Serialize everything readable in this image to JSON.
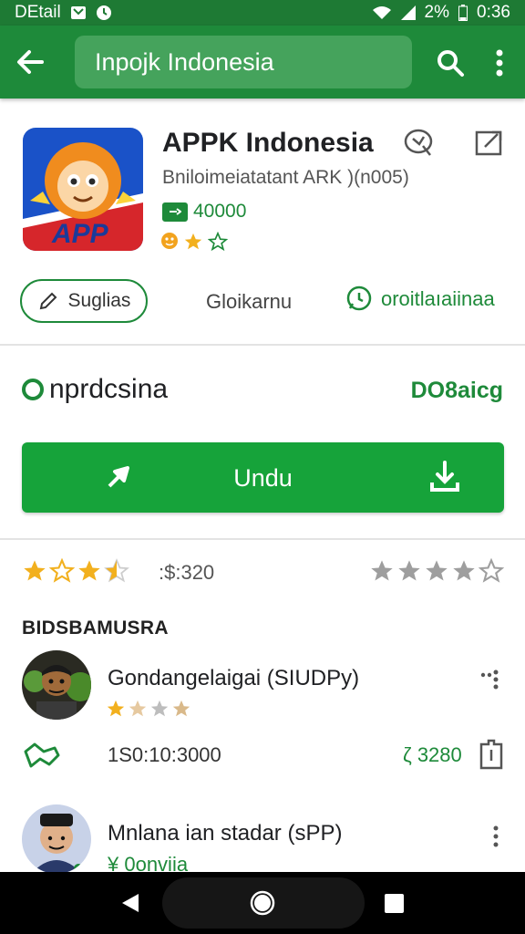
{
  "status_bar": {
    "left_label": "DEtail",
    "battery": "2%",
    "time": "0:36"
  },
  "search": {
    "value": "Inpojk Indonesia"
  },
  "app": {
    "title": "APPK Indonesia",
    "subtitle": "Bniloimeiatatant ARK )(n005)",
    "price": "40000",
    "icon_text": "APP"
  },
  "actions": {
    "pill_label": "Suglias",
    "mid_label": "Gloikarnu",
    "right_label": "oroitlaıaiinaa"
  },
  "install": {
    "label": "nprdcsina",
    "status": "DO8aicg"
  },
  "main_button": {
    "label": "Undu"
  },
  "rating": {
    "count_text": ":$:320",
    "value": 3.5
  },
  "reviews_section": {
    "title": "BIDSBAMUSRA",
    "reviews": [
      {
        "name": "Gondangelaigai (SIUDPy)",
        "date": "1S0:10:3000",
        "likes": "ζ 3280"
      },
      {
        "name": "Mnlana ian stadar (sPP)",
        "extra": "¥ 0onviia"
      }
    ]
  },
  "colors": {
    "primary": "#1e8a3a",
    "button": "#16a33a",
    "star": "#f2b01e"
  }
}
